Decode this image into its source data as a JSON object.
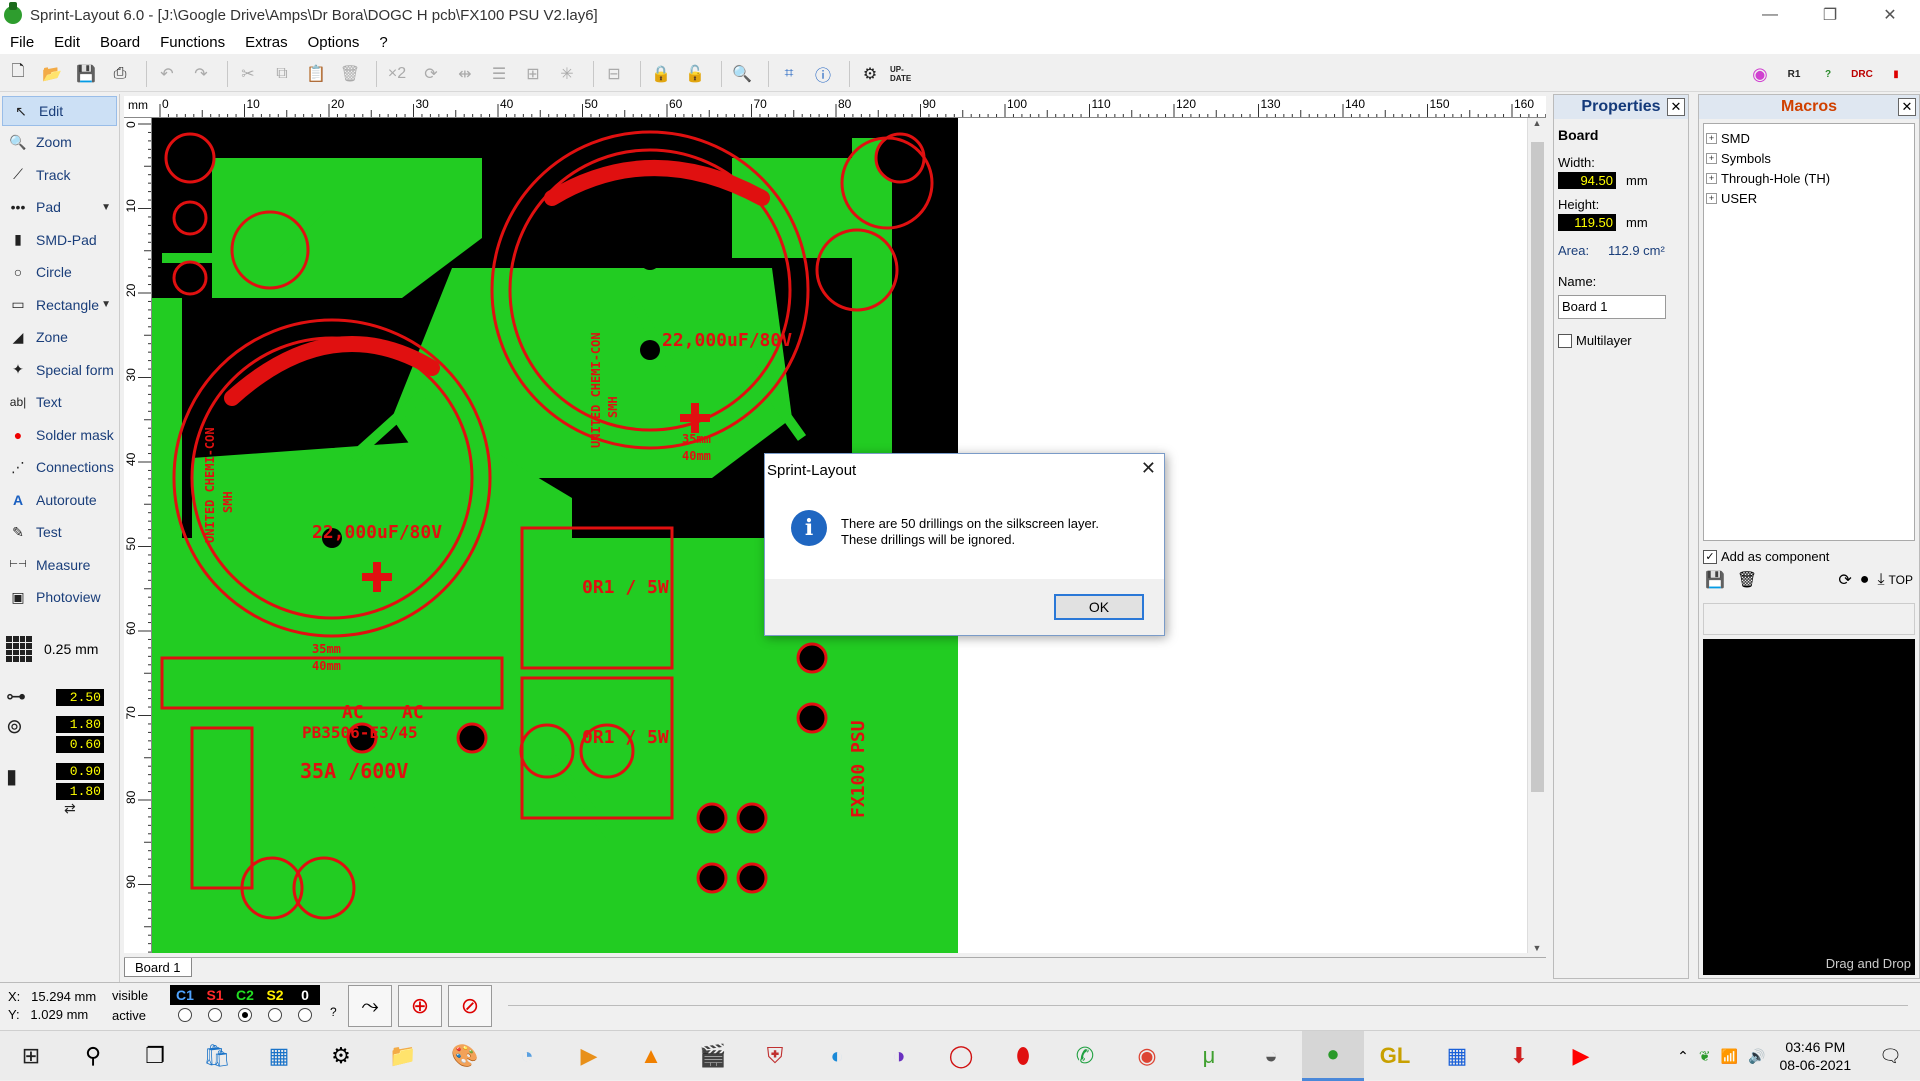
{
  "window": {
    "title": "Sprint-Layout 6.0 - [J:\\Google Drive\\Amps\\Dr Bora\\DOGC H pcb\\FX100 PSU V2.lay6]",
    "minimize": "—",
    "maximize": "❐",
    "close": "✕"
  },
  "menu": [
    "File",
    "Edit",
    "Board",
    "Functions",
    "Extras",
    "Options",
    "?"
  ],
  "toolbar_right": [
    "UP-DATE",
    "R1",
    "DRC"
  ],
  "tools": [
    {
      "label": "Edit",
      "icon": "cursor-icon",
      "glyph": "↖",
      "selected": true
    },
    {
      "label": "Zoom",
      "icon": "zoom-icon",
      "glyph": "🔍"
    },
    {
      "label": "Track",
      "icon": "track-icon",
      "glyph": "⟋"
    },
    {
      "label": "Pad",
      "icon": "pad-icon",
      "glyph": "•••",
      "dropdown": true
    },
    {
      "label": "SMD-Pad",
      "icon": "smd-pad-icon",
      "glyph": "▮"
    },
    {
      "label": "Circle",
      "icon": "circle-icon",
      "glyph": "○"
    },
    {
      "label": "Rectangle",
      "icon": "rectangle-icon",
      "glyph": "▭",
      "dropdown": true
    },
    {
      "label": "Zone",
      "icon": "zone-icon",
      "glyph": "◢"
    },
    {
      "label": "Special form",
      "icon": "special-form-icon",
      "glyph": "✦"
    },
    {
      "label": "Text",
      "icon": "text-icon",
      "glyph": "ab|"
    },
    {
      "label": "Solder mask",
      "icon": "solder-mask-icon",
      "glyph": "●"
    },
    {
      "label": "Connections",
      "icon": "connections-icon",
      "glyph": "⋰"
    },
    {
      "label": "Autoroute",
      "icon": "autoroute-icon",
      "glyph": "A"
    },
    {
      "label": "Test",
      "icon": "test-icon",
      "glyph": "✎"
    },
    {
      "label": "Measure",
      "icon": "measure-icon",
      "glyph": "⊢⊣"
    },
    {
      "label": "Photoview",
      "icon": "photoview-icon",
      "glyph": "▣"
    }
  ],
  "grid": {
    "value": "0.25 mm"
  },
  "sizes": {
    "track": "2.50",
    "pad_outer": "1.80",
    "pad_inner": "0.60",
    "smd_w": "0.90",
    "smd_h": "1.80"
  },
  "ruler": {
    "unit": "mm",
    "ticks_top": [
      "0",
      "10",
      "20",
      "30",
      "40",
      "50",
      "60",
      "70",
      "80",
      "90",
      "100",
      "110",
      "120",
      "130",
      "140",
      "150",
      "160"
    ],
    "ticks_left": [
      "0",
      "10",
      "20",
      "30",
      "40",
      "50",
      "60",
      "70",
      "80",
      "90"
    ]
  },
  "board_tab": "Board 1",
  "properties": {
    "title": "Properties",
    "section": "Board",
    "width_label": "Width:",
    "width": "94.50",
    "height_label": "Height:",
    "height": "119.50",
    "unit": "mm",
    "area_label": "Area:",
    "area": "112.9 cm²",
    "name_label": "Name:",
    "name": "Board 1",
    "multilayer": "Multilayer"
  },
  "macros": {
    "title": "Macros",
    "tree": [
      "SMD",
      "Symbols",
      "Through-Hole (TH)",
      "USER"
    ],
    "add_component": "Add as component",
    "top": "TOP",
    "drag": "Drag and Drop"
  },
  "status": {
    "x_label": "X:",
    "x": "15.294 mm",
    "y_label": "Y:",
    "y": "1.029 mm",
    "visible": "visible",
    "active": "active",
    "layers": [
      {
        "name": "C1",
        "color": "#4fa3ff"
      },
      {
        "name": "S1",
        "color": "#ff2a2a"
      },
      {
        "name": "C2",
        "color": "#22dd22"
      },
      {
        "name": "S2",
        "color": "#ffee00"
      },
      {
        "name": "0",
        "color": "#ffffff"
      }
    ],
    "active_index": 2,
    "help": "?"
  },
  "dialog": {
    "title": "Sprint-Layout",
    "line1": "There are 50 drillings on the silkscreen layer.",
    "line2": "These drillings will be ignored.",
    "ok": "OK"
  },
  "pcb_text": {
    "cap_large": "22,000uF/80V",
    "maker": "UNITED CHEMI-CON",
    "smh": "SMH",
    "r1": "0R1 / 5W",
    "rect": "PB3506-E3/45",
    "rect2": "35A /600V",
    "dim1": "35mm",
    "dim2": "40mm",
    "psu": "FX100 PSU",
    "ac": "AC"
  },
  "clock": {
    "time": "03:46 PM",
    "date": "08-06-2021"
  }
}
